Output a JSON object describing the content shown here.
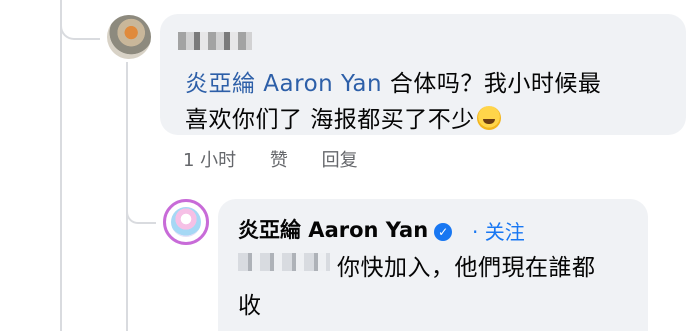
{
  "parent_comment": {
    "author_name": "",
    "mention": "炎亞綸 Aaron Yan",
    "text_line1_after_mention": " 合体吗？我小时候最",
    "text_line2": "喜欢你们了 海报都买了不少",
    "emoji": "rolling-on-floor-laughing",
    "actions": {
      "time": "1 小时",
      "like": "赞",
      "reply": "回复"
    }
  },
  "reply_comment": {
    "author_name": "炎亞綸 Aaron Yan",
    "verified": true,
    "follow_label": "· 关注",
    "text_line1": "你快加入，他們現在誰都",
    "text_line2": "收"
  }
}
